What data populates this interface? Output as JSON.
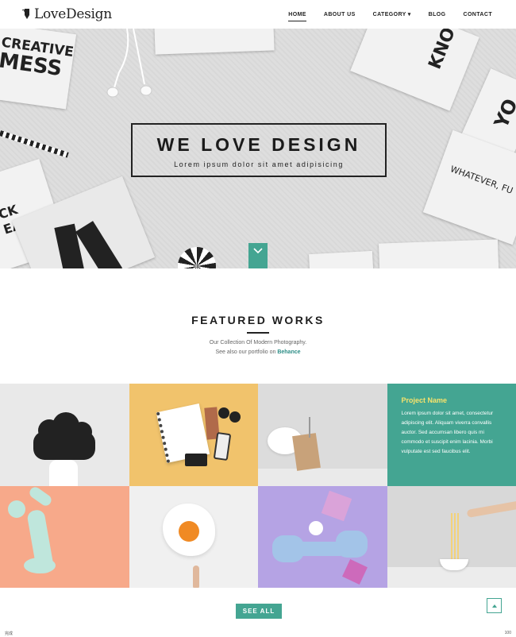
{
  "brand": {
    "name": "LoveDesign"
  },
  "nav": {
    "items": [
      {
        "label": "HOME",
        "active": true
      },
      {
        "label": "ABOUT US"
      },
      {
        "label": "CATEGORY",
        "dropdown": true
      },
      {
        "label": "BLOG"
      },
      {
        "label": "CONTACT"
      }
    ]
  },
  "hero": {
    "title": "WE LOVE DESIGN",
    "subtitle": "Lorem ipsum dolor sit amet adipisicing",
    "card_texts": [
      "CREATIVE",
      "MESS",
      "KNO",
      "YO",
      "WHATEVER, FU",
      "CK",
      "EAH!"
    ]
  },
  "featured": {
    "title": "FEATURED WORKS",
    "line1": "Our Collection Of Modern Photography.",
    "line2_prefix": "See also our portfolio on",
    "line2_link": "Behance"
  },
  "project": {
    "name": "Project Name",
    "description": "Lorem ipsum dolor sit amet, consectetur adipiscing elit. Aliquam viverra convallis auctor. Sed accumsan libero quis mi commodo et suscipit enim lacinia. Morbi vulputate est sed faucibus elit."
  },
  "actions": {
    "see_all": "SEE ALL"
  },
  "statusbar": {
    "left": "完成",
    "right": "100"
  },
  "colors": {
    "accent": "#44a592",
    "project_title": "#f7e36b"
  }
}
